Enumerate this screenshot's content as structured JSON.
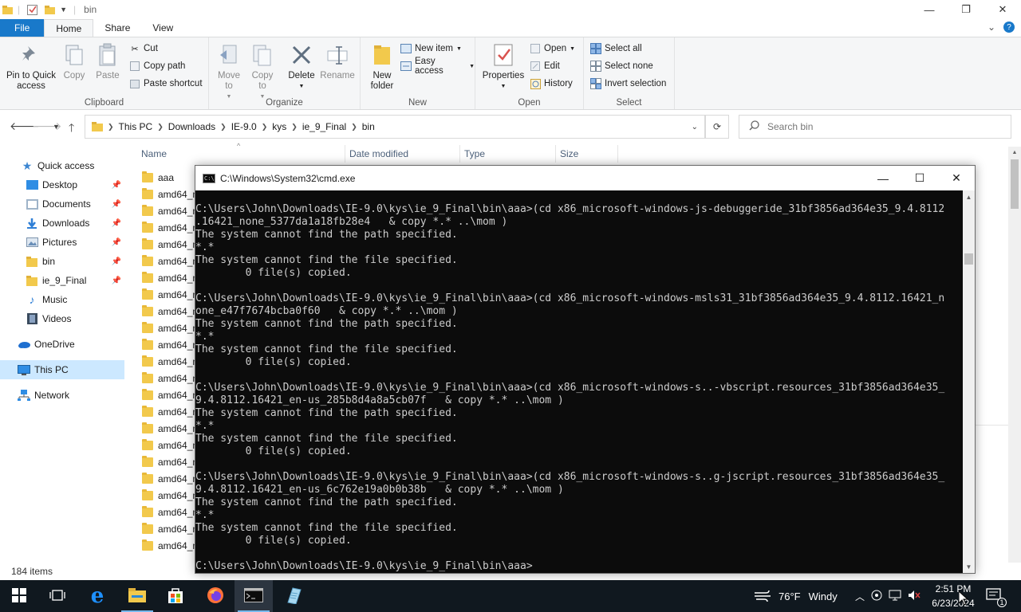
{
  "explorer": {
    "title": "bin",
    "window_buttons": {
      "minimize": "—",
      "maximize": "❐",
      "close": "✕"
    },
    "tabs": [
      "File",
      "Home",
      "Share",
      "View"
    ],
    "active_tab": "Home",
    "ribbon": {
      "clipboard": {
        "label": "Clipboard",
        "pin": "Pin to Quick access",
        "copy": "Copy",
        "paste": "Paste",
        "cut": "Cut",
        "copy_path": "Copy path",
        "paste_shortcut": "Paste shortcut"
      },
      "organize": {
        "label": "Organize",
        "move_to": "Move to",
        "copy_to": "Copy to",
        "delete": "Delete",
        "rename": "Rename"
      },
      "new": {
        "label": "New",
        "new_folder": "New folder",
        "new_item": "New item",
        "easy_access": "Easy access"
      },
      "open": {
        "label": "Open",
        "properties": "Properties",
        "open": "Open",
        "edit": "Edit",
        "history": "History"
      },
      "select": {
        "label": "Select",
        "select_all": "Select all",
        "select_none": "Select none",
        "invert_selection": "Invert selection"
      }
    },
    "address": {
      "crumbs": [
        "This PC",
        "Downloads",
        "IE-9.0",
        "kys",
        "ie_9_Final",
        "bin"
      ]
    },
    "search_placeholder": "Search bin",
    "nav_pane": {
      "quick_access": "Quick access",
      "pinned": [
        "Desktop",
        "Documents",
        "Downloads",
        "Pictures",
        "bin",
        "ie_9_Final"
      ],
      "unpinned": [
        "Music",
        "Videos"
      ],
      "onedrive": "OneDrive",
      "this_pc": "This PC",
      "network": "Network"
    },
    "columns": {
      "name": "Name",
      "date": "Date modified",
      "type": "Type",
      "size": "Size"
    },
    "files": [
      "aaa",
      "amd64_m",
      "amd64_m",
      "amd64_m",
      "amd64_m",
      "amd64_m",
      "amd64_m",
      "amd64_m",
      "amd64_m",
      "amd64_m",
      "amd64_m",
      "amd64_m",
      "amd64_m",
      "amd64_m",
      "amd64_m",
      "amd64_m",
      "amd64_m",
      "amd64_m",
      "amd64_m",
      "amd64_m",
      "amd64_m",
      "amd64_m",
      "amd64_m"
    ],
    "status": "184 items"
  },
  "cmd": {
    "title": "C:\\Windows\\System32\\cmd.exe",
    "lines": [
      "C:\\Users\\John\\Downloads\\IE-9.0\\kys\\ie_9_Final\\bin\\aaa>(cd x86_microsoft-windows-js-debuggeride_31bf3856ad364e35_9.4.8112",
      ".16421_none_5377da1a18fb28e4   & copy *.* ..\\mom )",
      "The system cannot find the path specified.",
      "*.*",
      "The system cannot find the file specified.",
      "        0 file(s) copied.",
      "",
      "C:\\Users\\John\\Downloads\\IE-9.0\\kys\\ie_9_Final\\bin\\aaa>(cd x86_microsoft-windows-msls31_31bf3856ad364e35_9.4.8112.16421_n",
      "one_e47f7674bcba0f60   & copy *.* ..\\mom )",
      "The system cannot find the path specified.",
      "*.*",
      "The system cannot find the file specified.",
      "        0 file(s) copied.",
      "",
      "C:\\Users\\John\\Downloads\\IE-9.0\\kys\\ie_9_Final\\bin\\aaa>(cd x86_microsoft-windows-s..-vbscript.resources_31bf3856ad364e35_",
      "9.4.8112.16421_en-us_285b8d4a8a5cb07f   & copy *.* ..\\mom )",
      "The system cannot find the path specified.",
      "*.*",
      "The system cannot find the file specified.",
      "        0 file(s) copied.",
      "",
      "C:\\Users\\John\\Downloads\\IE-9.0\\kys\\ie_9_Final\\bin\\aaa>(cd x86_microsoft-windows-s..g-jscript.resources_31bf3856ad364e35_",
      "9.4.8112.16421_en-us_6c762e19a0b0b38b   & copy *.* ..\\mom )",
      "The system cannot find the path specified.",
      "*.*",
      "The system cannot find the file specified.",
      "        0 file(s) copied.",
      "",
      "C:\\Users\\John\\Downloads\\IE-9.0\\kys\\ie_9_Final\\bin\\aaa>"
    ]
  },
  "taskbar": {
    "weather_temp": "76°F",
    "weather_text": "Windy",
    "time": "2:51 PM",
    "date": "6/23/2024",
    "notification_count": "1",
    "icons": [
      "start-icon",
      "task-view-icon",
      "edge-icon",
      "file-explorer-icon",
      "store-icon",
      "firefox-icon",
      "cmd-icon",
      "notepad-icon"
    ]
  },
  "colors": {
    "file_tab": "#1979ca",
    "taskbar": "#10181f",
    "selection": "#cce8ff",
    "console_bg": "#0c0c0c",
    "console_text": "#cccccc"
  }
}
